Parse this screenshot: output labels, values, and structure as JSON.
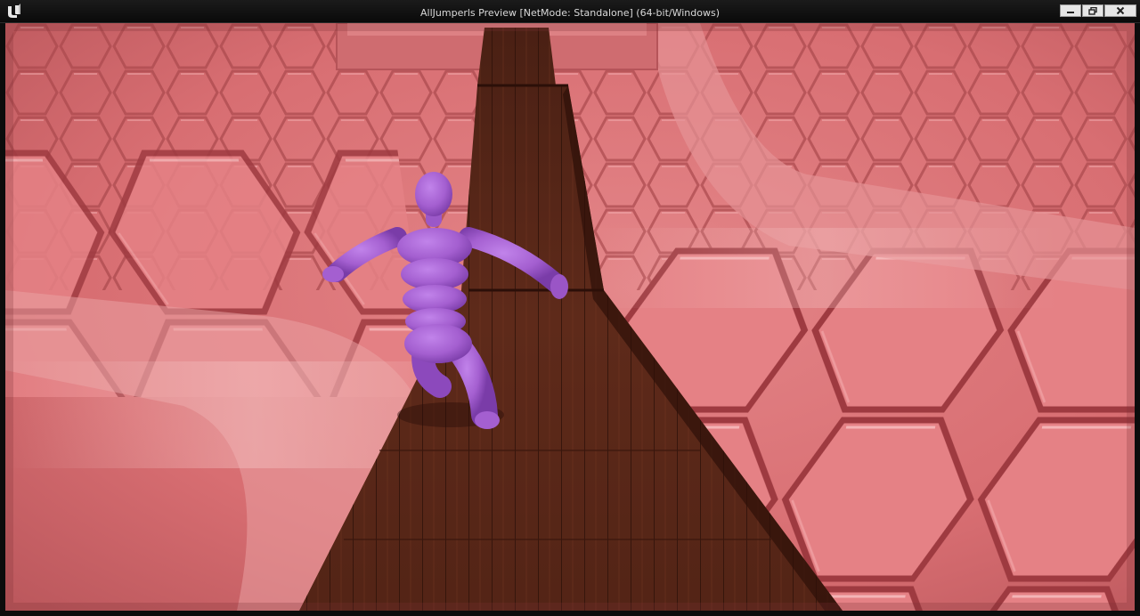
{
  "window": {
    "title": "AllJumperls Preview [NetMode: Standalone] (64-bit/Windows)",
    "controls": {
      "minimize": "minimize-icon",
      "restore": "restore-icon",
      "close": "close-icon"
    }
  },
  "app": {
    "logo_icon": "unreal-engine-logo-icon"
  },
  "scene": {
    "description_icons": [
      "player-character",
      "wooden-walkway",
      "hexagon-floor"
    ],
    "colors": {
      "floor": "#d96f72",
      "floor_highlight": "#f0a2a4",
      "floor_groove": "#9e3a40",
      "wood": "#5a2a1a",
      "wood_dark": "#3a170e",
      "character": "#a45fd0",
      "character_shadow": "#7a3ca8"
    }
  }
}
